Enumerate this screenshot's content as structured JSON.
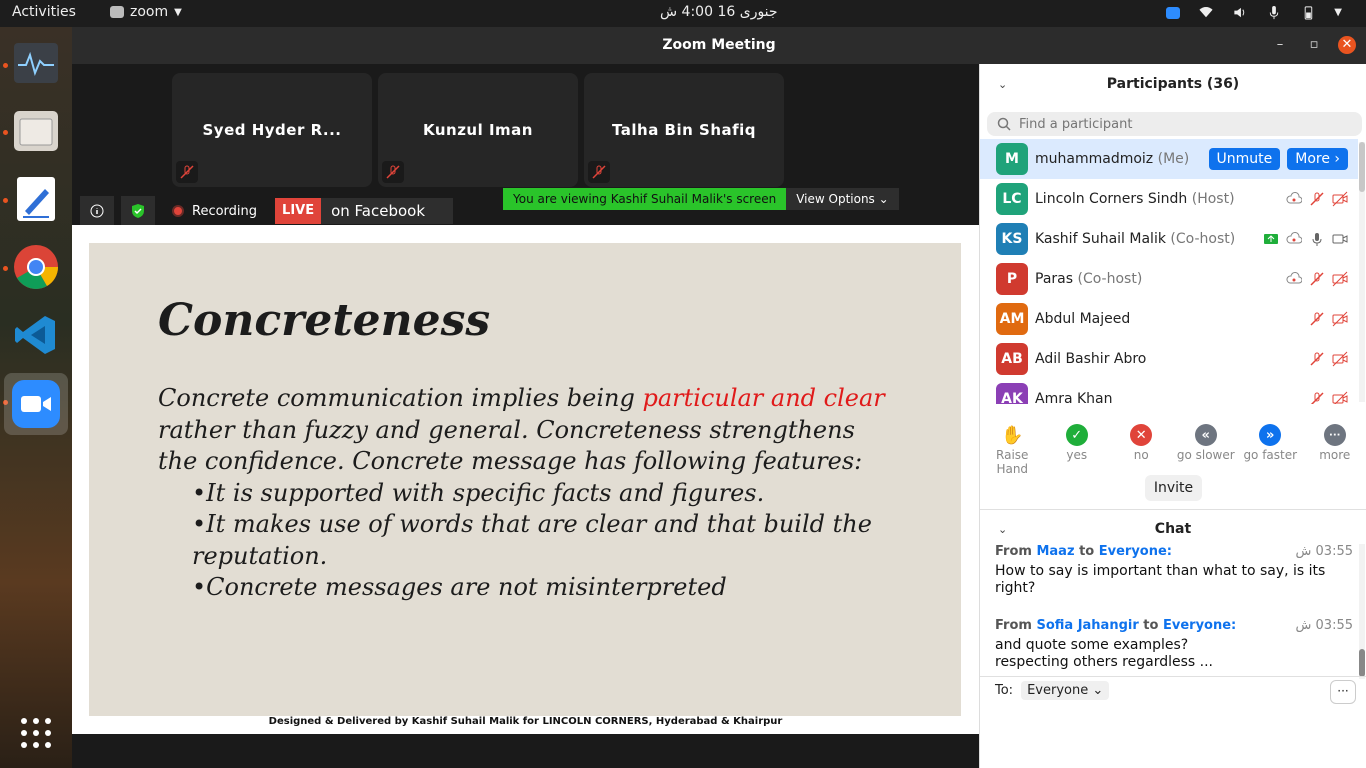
{
  "topbar": {
    "activities": "Activities",
    "app_name": "zoom",
    "clock": "جنوری 16  4:00 ش"
  },
  "window": {
    "title": "Zoom Meeting"
  },
  "tiles": [
    {
      "name": "Syed Hyder R..."
    },
    {
      "name": "Kunzul Iman"
    },
    {
      "name": "Talha Bin Shafiq"
    }
  ],
  "infobar": {
    "recording": "Recording",
    "live": "LIVE",
    "live_on": "on Facebook"
  },
  "viewing": {
    "banner": "You are viewing Kashif Suhail Malik's screen",
    "options": "View Options ⌄"
  },
  "slide": {
    "title": "Concreteness",
    "intro_a": "Concrete communication implies being ",
    "intro_highlight": "particular and clear",
    "intro_b": " rather than fuzzy and general. Concreteness strengthens the confidence. Concrete message has following features:",
    "bullets": [
      "•It is supported with specific facts and figures.",
      "•It makes use of words that are clear and that build the reputation.",
      "•Concrete messages are not misinterpreted"
    ],
    "footer": "Designed & Delivered by Kashif Suhail Malik for LINCOLN CORNERS, Hyderabad & Khairpur"
  },
  "participants": {
    "header": "Participants (36)",
    "search_placeholder": "Find a participant",
    "unmute": "Unmute",
    "more": "More ›",
    "list": [
      {
        "initials": "M",
        "name": "muhammadmoiz",
        "role": "(Me)",
        "color": "#1fa37a"
      },
      {
        "initials": "LC",
        "name": "Lincoln Corners Sindh",
        "role": "(Host)",
        "color": "#1fa37a"
      },
      {
        "initials": "KS",
        "name": "Kashif Suhail Malik",
        "role": "(Co-host)",
        "color": "#1f7fb5"
      },
      {
        "initials": "P",
        "name": "Paras",
        "role": "(Co-host)",
        "color": "#d03a2f"
      },
      {
        "initials": "AM",
        "name": "Abdul Majeed",
        "role": "",
        "color": "#e06a10"
      },
      {
        "initials": "AB",
        "name": "Adil Bashir Abro",
        "role": "",
        "color": "#d03a2f"
      },
      {
        "initials": "AK",
        "name": "Amra Khan",
        "role": "",
        "color": "#8b3fb5"
      }
    ]
  },
  "reactions": [
    {
      "label": "Raise Hand",
      "glyph": "✋",
      "color": "#ffffff"
    },
    {
      "label": "yes",
      "glyph": "✓",
      "color": "#1fae3a"
    },
    {
      "label": "no",
      "glyph": "✕",
      "color": "#e0443a"
    },
    {
      "label": "go slower",
      "glyph": "«",
      "color": "#6e7580"
    },
    {
      "label": "go faster",
      "glyph": "»",
      "color": "#0e72ed"
    },
    {
      "label": "more",
      "glyph": "···",
      "color": "#6e7580"
    }
  ],
  "invite": "Invite",
  "chat": {
    "header": "Chat",
    "messages": [
      {
        "from_label": "From",
        "sender": "Maaz",
        "to_label": "to",
        "recipient": "Everyone:",
        "time": "03:55 ش",
        "text": "How to say is important than what to say, is its right?"
      },
      {
        "from_label": "From",
        "sender": "Sofia Jahangir",
        "to_label": "to",
        "recipient": "Everyone:",
        "time": "03:55 ش",
        "text": "and quote some examples?\nrespecting others regardless ..."
      }
    ],
    "to_label": "To:",
    "to_value": "Everyone ⌄",
    "more": "···"
  }
}
